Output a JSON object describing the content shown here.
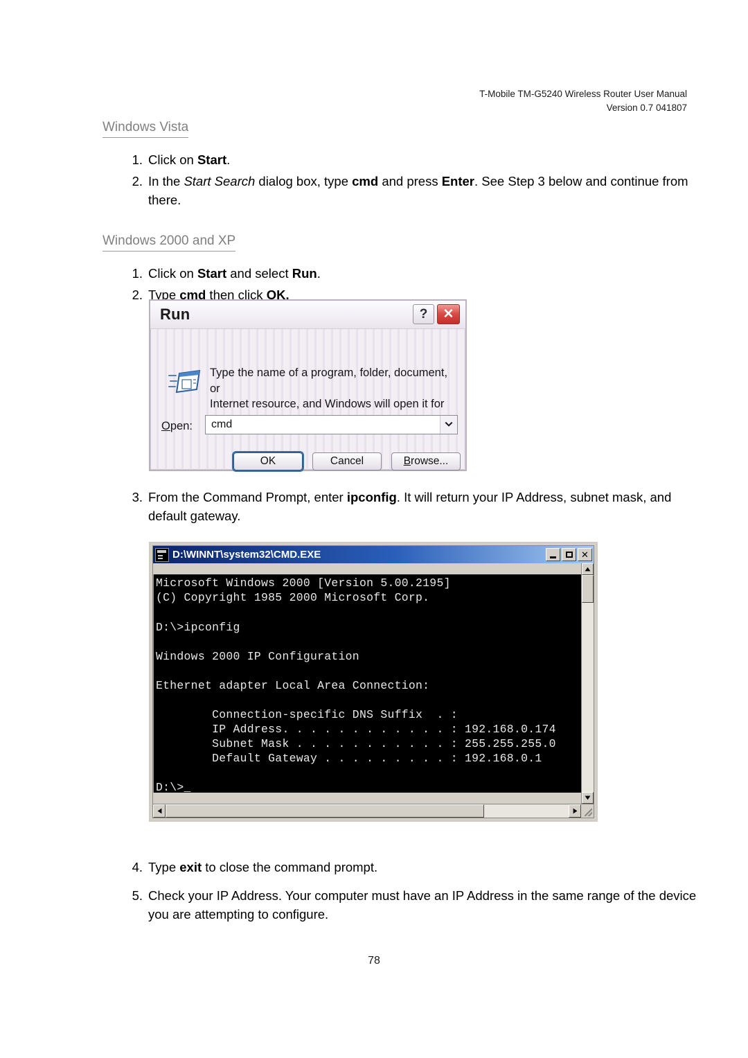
{
  "document": {
    "header_line1": "T-Mobile TM-G5240 Wireless Router User Manual",
    "header_line2": "Version 0.7 041807",
    "page_number": "78"
  },
  "sections": [
    {
      "heading": "Windows Vista",
      "steps": [
        {
          "num": "1.",
          "html": "Click on <b>Start</b>."
        },
        {
          "num": "2.",
          "html": "In the <i>Start Search</i> dialog box, type <b>cmd</b> and press <b>Enter</b>. See Step 3 below and continue from there."
        }
      ]
    },
    {
      "heading": "Windows 2000 and XP",
      "steps": [
        {
          "num": "1.",
          "html": "Click on <b>Start</b> and select <b>Run</b>."
        },
        {
          "num": "2.",
          "html": "Type <b>cmd</b> then click <b>OK.</b>"
        }
      ]
    }
  ],
  "steps_after_run": [
    {
      "num": "3.",
      "html": "From the Command Prompt, enter <b>ipconfig</b>. It will return your IP Address, subnet mask, and default gateway."
    }
  ],
  "steps_after_cmd": [
    {
      "num": "4.",
      "html": "Type <b>exit</b> to close the command prompt."
    },
    {
      "num": "5.",
      "html": "Check your IP Address. Your computer must have an IP Address in the same range of the device you are attempting to configure."
    }
  ],
  "run_dialog": {
    "title": "Run",
    "help_label": "?",
    "close_label": "✕",
    "prompt_line1": "Type the name of a program, folder, document, or",
    "prompt_line2": "Internet resource, and Windows will open it for you.",
    "open_label_prefix": "O",
    "open_label_suffix": "pen:",
    "open_value": "cmd",
    "buttons": {
      "ok": "OK",
      "cancel": "Cancel",
      "browse_prefix": "B",
      "browse_suffix": "rowse..."
    },
    "colors": {
      "titlebar_text": "#1b1b1b",
      "close_red": "#da4b45",
      "default_focus": "#3a6ea5"
    }
  },
  "cmd_window": {
    "title": "D:\\WINNT\\system32\\CMD.EXE",
    "minimize_label": "_",
    "maximize_label": "□",
    "close_label": "✕",
    "console_text": "Microsoft Windows 2000 [Version 5.00.2195]\n(C) Copyright 1985 2000 Microsoft Corp.\n\nD:\\>ipconfig\n\nWindows 2000 IP Configuration\n\nEthernet adapter Local Area Connection:\n\n        Connection-specific DNS Suffix  . :\n        IP Address. . . . . . . . . . . . : 192.168.0.174\n        Subnet Mask . . . . . . . . . . . : 255.255.255.0\n        Default Gateway . . . . . . . . . : 192.168.0.1\n\nD:\\>_",
    "ipconfig": {
      "command": "ipconfig",
      "os_banner": "Microsoft Windows 2000 [Version 5.00.2195]",
      "copyright": "(C) Copyright 1985 2000 Microsoft Corp.",
      "prompt": "D:\\>",
      "config_title": "Windows 2000 IP Configuration",
      "adapter": "Ethernet adapter Local Area Connection:",
      "dns_suffix_label": "Connection-specific DNS Suffix",
      "dns_suffix_value": "",
      "ip_address_label": "IP Address",
      "ip_address": "192.168.0.174",
      "subnet_mask_label": "Subnet Mask",
      "subnet_mask": "255.255.255.0",
      "default_gateway_label": "Default Gateway",
      "default_gateway": "192.168.0.1"
    },
    "scroll": {
      "vertical_thumb_position": "top",
      "horizontal_thumb_width_percent": 79,
      "up_arrow": "▲",
      "down_arrow": "▼",
      "left_arrow": "◄",
      "right_arrow": "►"
    }
  }
}
